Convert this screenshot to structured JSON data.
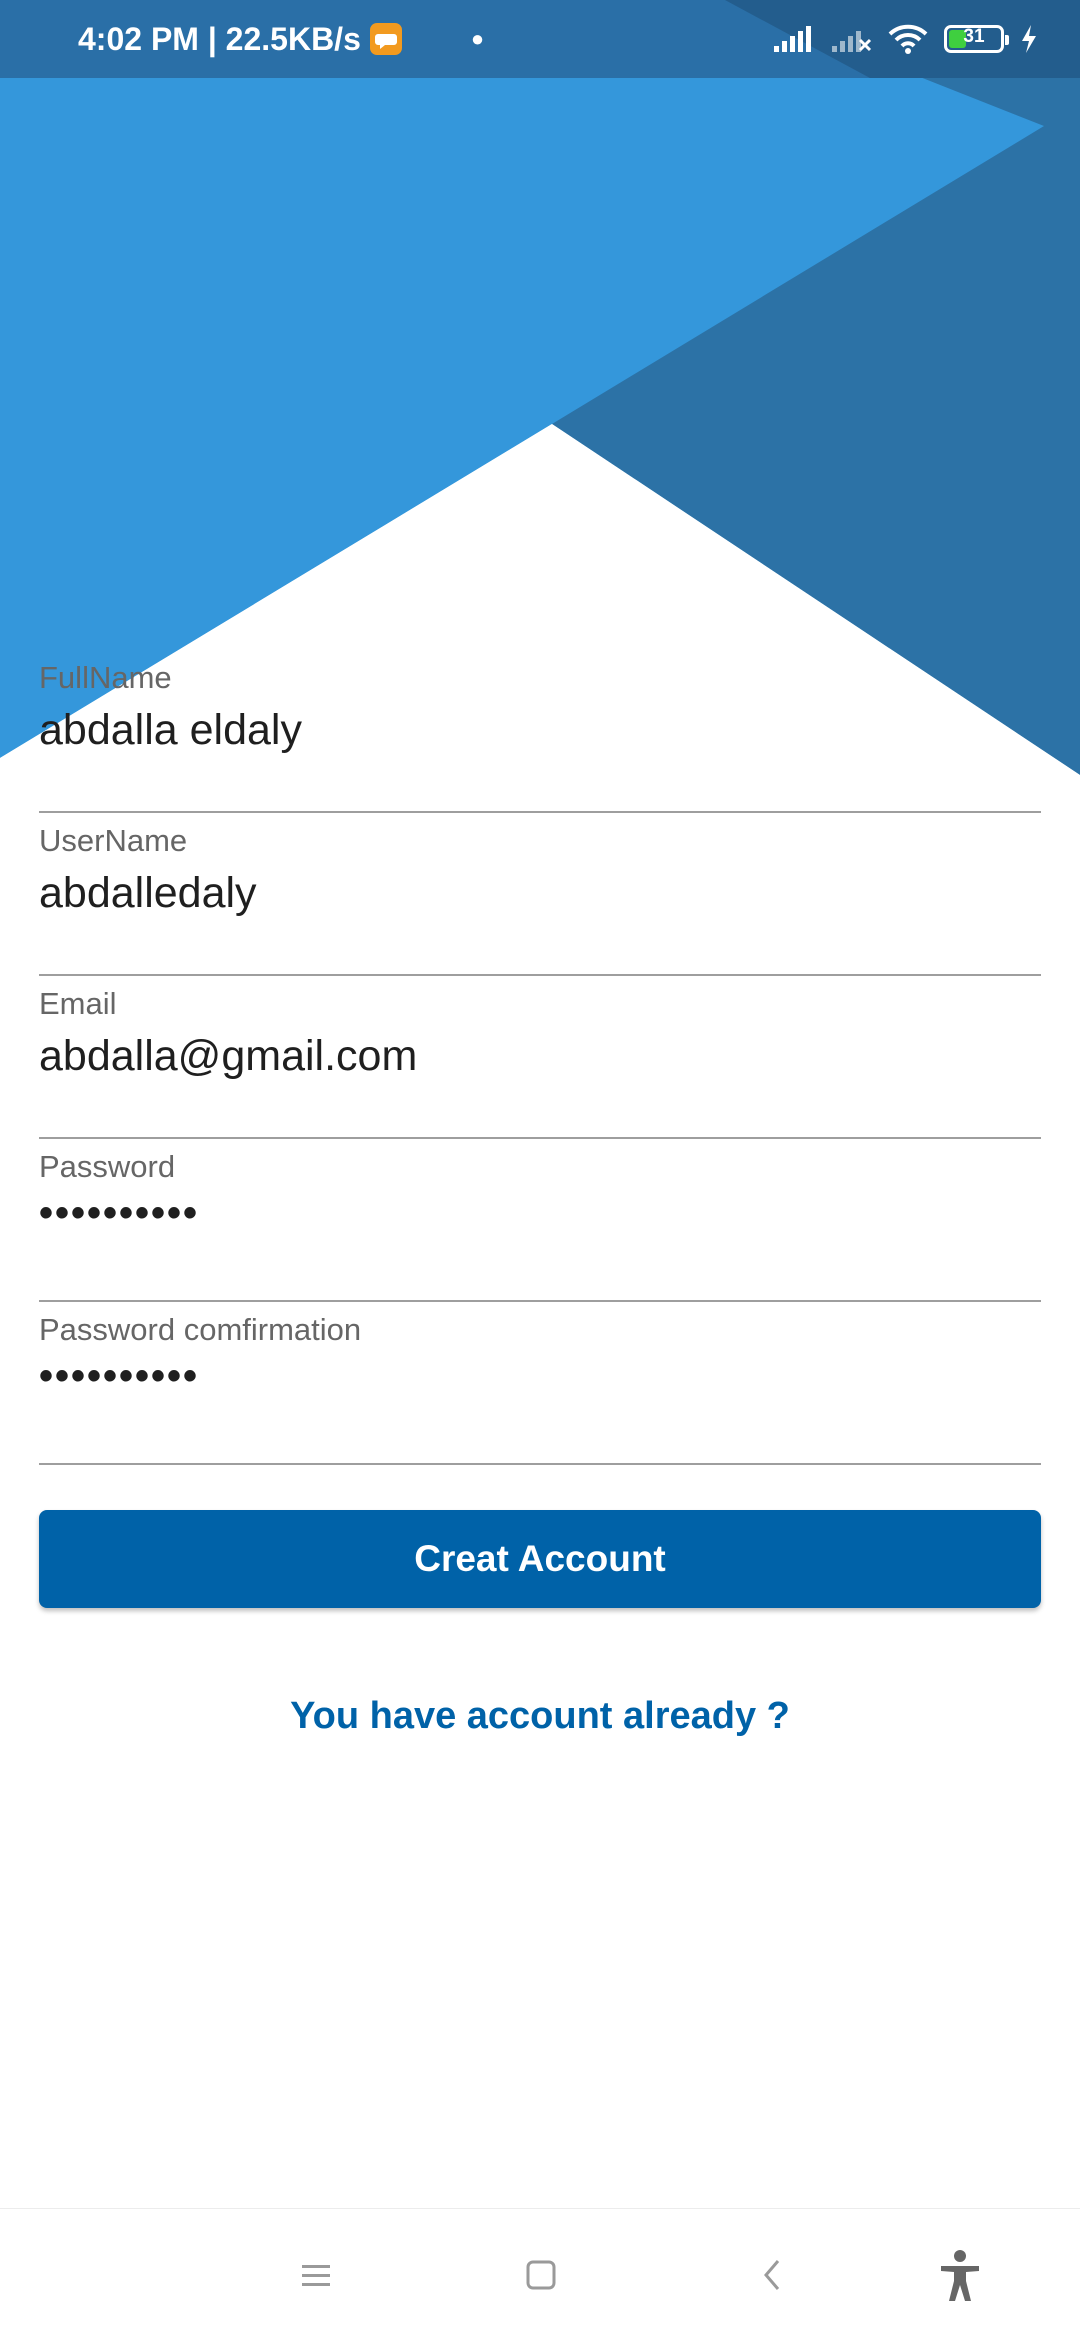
{
  "status_bar": {
    "time_speed": "4:02 PM | 22.5KB/s",
    "battery_level": "31",
    "icons": [
      "message-icon",
      "signal-icon",
      "signal-off-icon",
      "wifi-icon",
      "battery-icon",
      "charging-icon"
    ]
  },
  "form": {
    "fullname": {
      "label": "FullName",
      "value": "abdalla eldaly"
    },
    "username": {
      "label": "UserName",
      "value": "abdalledaly"
    },
    "email": {
      "label": "Email",
      "value": "abdalla@gmail.com"
    },
    "password": {
      "label": "Password",
      "value": "••••••••••"
    },
    "password_confirm": {
      "label": "Password comfirmation",
      "value": "••••••••••"
    }
  },
  "actions": {
    "create_label": "Creat Account",
    "login_link": "You have account already ?"
  },
  "nav_bar": {
    "icons": [
      "menu-icon",
      "home-icon",
      "back-icon",
      "accessibility-icon"
    ]
  },
  "colors": {
    "primary": "#0062a8",
    "header_light": "#3497db",
    "header_dark": "#2c72a6",
    "status_bar": "#2367a0"
  }
}
